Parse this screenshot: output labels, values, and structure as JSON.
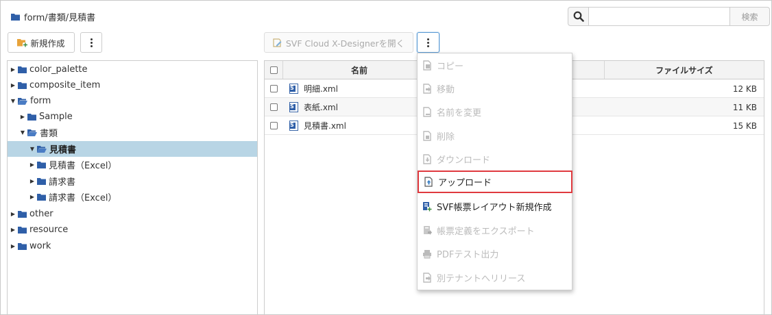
{
  "breadcrumb": {
    "path": "form/書類/見積書",
    "icon": "folder-icon"
  },
  "search": {
    "placeholder": "",
    "value": "",
    "submit_label": "検索",
    "icon": "search-icon"
  },
  "toolbar": {
    "new_label": "新規作成",
    "designer_label": "SVF Cloud X-Designerを開く"
  },
  "tree": {
    "items": [
      {
        "label": "color_palette",
        "expanded": false,
        "level": 0,
        "selected": false
      },
      {
        "label": "composite_item",
        "expanded": false,
        "level": 0,
        "selected": false
      },
      {
        "label": "form",
        "expanded": true,
        "level": 0,
        "selected": false
      },
      {
        "label": "Sample",
        "expanded": false,
        "level": 1,
        "selected": false
      },
      {
        "label": "書類",
        "expanded": true,
        "level": 1,
        "selected": false
      },
      {
        "label": "見積書",
        "expanded": true,
        "level": 2,
        "selected": true
      },
      {
        "label": "見積書（Excel）",
        "expanded": false,
        "level": 2,
        "selected": false
      },
      {
        "label": "請求書",
        "expanded": false,
        "level": 2,
        "selected": false
      },
      {
        "label": "請求書（Excel）",
        "expanded": false,
        "level": 2,
        "selected": false
      },
      {
        "label": "other",
        "expanded": false,
        "level": 0,
        "selected": false
      },
      {
        "label": "resource",
        "expanded": false,
        "level": 0,
        "selected": false
      },
      {
        "label": "work",
        "expanded": false,
        "level": 0,
        "selected": false
      }
    ]
  },
  "table": {
    "columns": {
      "name": "名前",
      "size": "ファイルサイズ"
    },
    "rows": [
      {
        "name": "明細.xml",
        "size": "12 KB"
      },
      {
        "name": "表紙.xml",
        "size": "11 KB"
      },
      {
        "name": "見積書.xml",
        "size": "15 KB"
      }
    ]
  },
  "menu": {
    "items": [
      {
        "label": "コピー",
        "enabled": false,
        "icon": "copy-icon"
      },
      {
        "label": "移動",
        "enabled": false,
        "icon": "move-icon"
      },
      {
        "label": "名前を変更",
        "enabled": false,
        "icon": "rename-icon"
      },
      {
        "label": "削除",
        "enabled": false,
        "icon": "delete-icon"
      },
      {
        "label": "ダウンロード",
        "enabled": false,
        "icon": "download-icon"
      },
      {
        "label": "アップロード",
        "enabled": true,
        "icon": "upload-icon",
        "highlighted": true
      },
      {
        "label": "SVF帳票レイアウト新規作成",
        "enabled": true,
        "icon": "new-layout-icon"
      },
      {
        "label": "帳票定義をエクスポート",
        "enabled": false,
        "icon": "export-icon"
      },
      {
        "label": "PDFテスト出力",
        "enabled": false,
        "icon": "print-icon"
      },
      {
        "label": "別テナントへリリース",
        "enabled": false,
        "icon": "release-icon"
      }
    ]
  },
  "colors": {
    "folder": "#2f5fa8",
    "selected_row": "#b8d5e5",
    "highlight_border": "#e0393e",
    "active_border": "#5b9bd5"
  }
}
